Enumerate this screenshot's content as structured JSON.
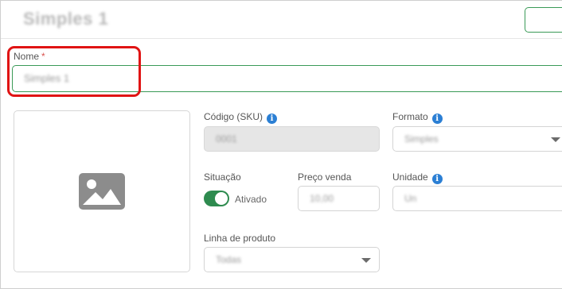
{
  "header": {
    "title": "Simples 1",
    "action_button_label": ""
  },
  "form": {
    "name_label": "Nome",
    "name_required_mark": "*",
    "name_value": "Simples 1",
    "sku_label": "Código (SKU)",
    "sku_value": "0001",
    "format_label": "Formato",
    "format_value": "Simples",
    "status_label": "Situação",
    "status_toggle_text": "Ativado",
    "status_on": true,
    "price_label": "Preço venda",
    "price_value": "10,00",
    "unit_label": "Unidade",
    "unit_value": "Un",
    "product_line_label": "Linha de produto",
    "product_line_value": "Todas"
  },
  "icons": {
    "image_placeholder": "image-icon",
    "info": "info-icon",
    "select_caret": "caret-down-icon"
  },
  "colors": {
    "accent_green": "#3a9a57",
    "toggle_green": "#2e8b4f",
    "info_blue": "#2b7fd4",
    "highlight_red": "#e01414",
    "placeholder_gray": "#8c8c8c"
  }
}
